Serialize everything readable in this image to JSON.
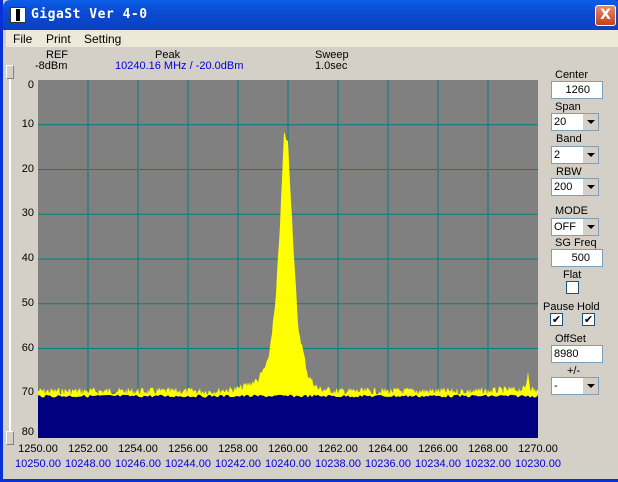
{
  "window": {
    "title": "GigaSt Ver 4-0",
    "close_label": "X"
  },
  "menu": [
    "File",
    "Print",
    "Setting"
  ],
  "header": {
    "ref_label": "REF",
    "ref_value": "-8dBm",
    "peak_label": "Peak",
    "peak_value": "10240.16 MHz / -20.0dBm",
    "sweep_label": "Sweep",
    "sweep_value": "1.0sec"
  },
  "controls": {
    "center_label": "Center",
    "center_value": "1260",
    "span_label": "Span",
    "span_value": "20",
    "band_label": "Band",
    "band_value": "2",
    "rbw_label": "RBW",
    "rbw_value": "200",
    "mode_label": "MODE",
    "mode_value": "OFF",
    "sgfreq_label": "SG Freq",
    "sgfreq_value": "500",
    "flat_label": "Flat",
    "flat_checked": false,
    "pause_label": "Pause",
    "pause_checked": true,
    "hold_label": "Hold",
    "hold_checked": true,
    "offset_label": "OffSet",
    "offset_value": "8980",
    "sign_label": "+/-",
    "sign_value": "-"
  },
  "colors": {
    "plot_bg": "#808080",
    "grid": "#008080",
    "trace": "#ffff00",
    "fill": "#000080",
    "blue_text": "#0000e0"
  },
  "chart_data": {
    "type": "area",
    "ylabel": "",
    "y_ticks": [
      "0",
      "10",
      "20",
      "30",
      "40",
      "50",
      "60",
      "70",
      "80"
    ],
    "ylim": [
      0,
      80
    ],
    "x_ticks_top": [
      "1250.00",
      "1252.00",
      "1254.00",
      "1256.00",
      "1258.00",
      "1260.00",
      "1262.00",
      "1264.00",
      "1266.00",
      "1268.00",
      "1270.00"
    ],
    "x_ticks_bottom": [
      "10250.00",
      "10248.00",
      "10246.00",
      "10244.00",
      "10242.00",
      "10240.00",
      "10238.00",
      "10236.00",
      "10234.00",
      "10232.00",
      "10230.00"
    ],
    "xlim": [
      1250,
      1270
    ],
    "series": [
      {
        "x": [
          1250,
          1252,
          1254,
          1256,
          1257,
          1258,
          1258.8,
          1259.2,
          1259.5,
          1259.7,
          1259.84,
          1260.0,
          1260.2,
          1260.4,
          1260.8,
          1261.2,
          1262,
          1264,
          1266,
          1268,
          1269.5,
          1269.6,
          1269.7,
          1270
        ],
        "y": [
          69.5,
          69.5,
          69.5,
          69.5,
          69.5,
          69,
          67,
          63,
          50,
          30,
          12,
          14,
          35,
          55,
          66,
          69,
          69.5,
          69.5,
          69.5,
          69.5,
          69,
          65,
          69,
          69.5
        ]
      }
    ],
    "noise_floor_fill": 70.5,
    "grid": true
  }
}
